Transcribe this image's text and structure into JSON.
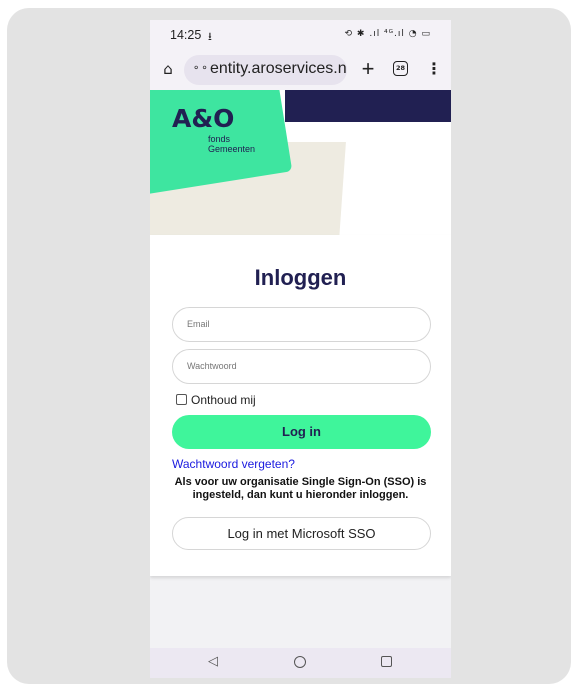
{
  "status_bar": {
    "time": "14:25",
    "download_indicator": "⭳",
    "icons": "⟲ ✱ .ıl ⁴ᴳ.ıl ◔ ▭"
  },
  "browser": {
    "url": "entity.aroservices.nl",
    "url_icon": "⚬⚬",
    "home_icon": "⌂",
    "new_tab_label": "+",
    "tab_count": "28",
    "menu_icon": "⋮"
  },
  "brand": {
    "logo_main": "A&O",
    "logo_sub_line1": "fonds",
    "logo_sub_line2": "Gemeenten",
    "colors": {
      "navy": "#212052",
      "green": "#3ee5a0",
      "button_green": "#3ff59b",
      "cream": "#eeebe1",
      "link_blue": "#1a1adf"
    }
  },
  "login": {
    "title": "Inloggen",
    "email_placeholder": "Email",
    "password_placeholder": "Wachtwoord",
    "remember_label": "Onthoud mij",
    "remember_checked": false,
    "submit_label": "Log in",
    "forgot_label": "Wachtwoord vergeten?",
    "sso_info": "Als voor uw organisatie Single Sign-On (SSO) is ingesteld, dan kunt u hieronder inloggen.",
    "sso_button_label": "Log in met Microsoft SSO"
  },
  "nav_bar": {
    "back_icon": "◁",
    "home_icon": "○",
    "recent_icon": "□"
  }
}
